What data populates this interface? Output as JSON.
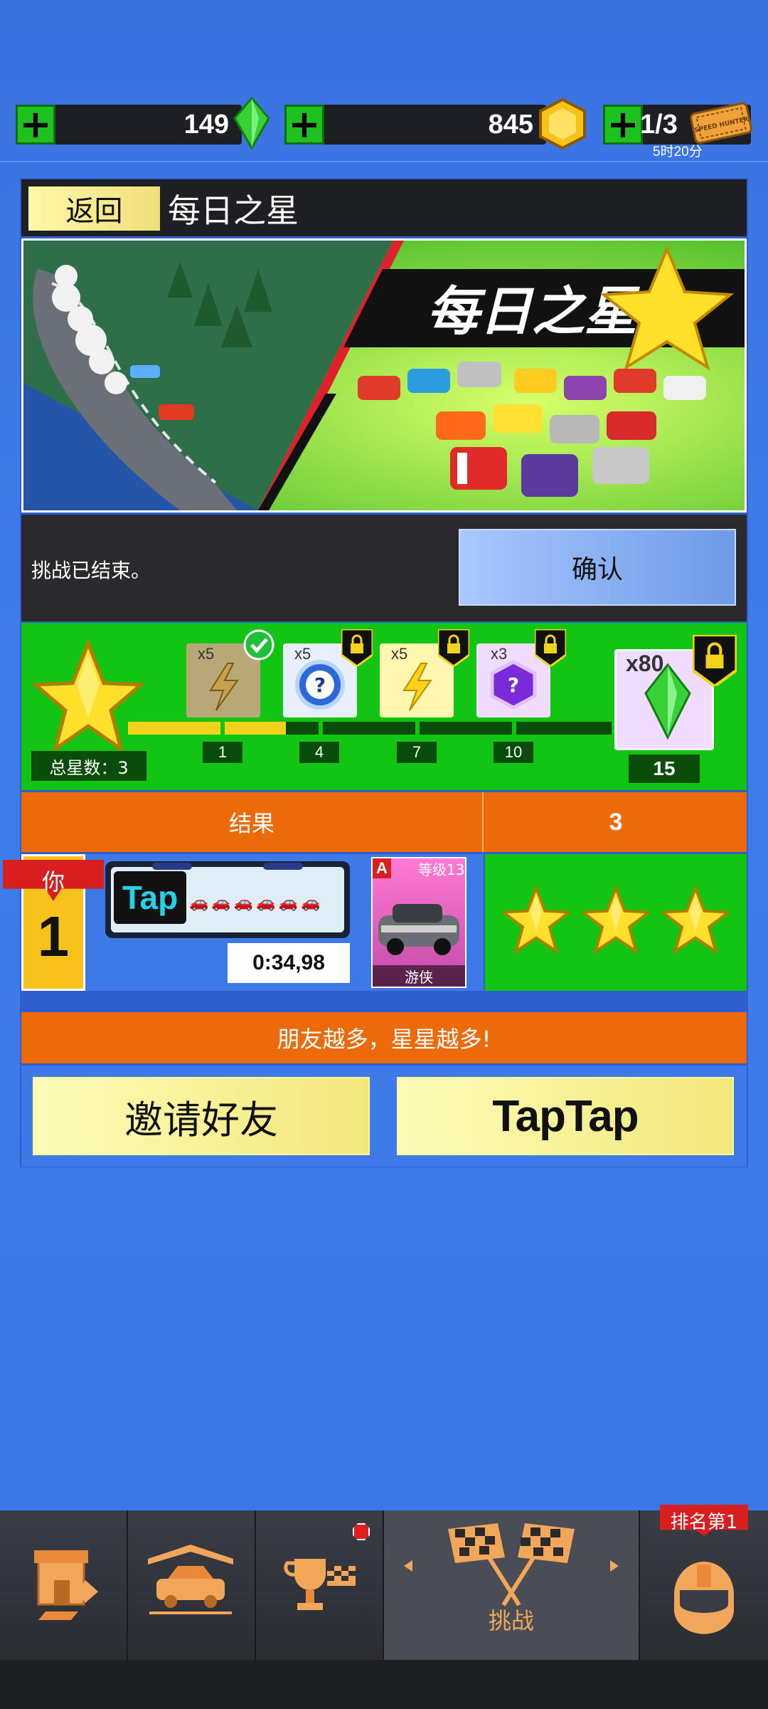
{
  "currencies": {
    "gems": {
      "value": "149",
      "icon": "green-gem-icon"
    },
    "coins": {
      "value": "845",
      "icon": "gold-coin-icon"
    },
    "tickets": {
      "value": "1/3",
      "timer": "5时20分",
      "icon": "speed-hunter-ticket-icon",
      "ticket_text": "SPEED HUNTER"
    }
  },
  "header": {
    "back_label": "返回",
    "title": "每日之星"
  },
  "banner": {
    "title": "每日之星"
  },
  "status": {
    "message": "挑战已结束。",
    "confirm_label": "确认"
  },
  "rewards": {
    "total_stars_label": "总星数：3",
    "tiers": [
      {
        "multiplier": "x5",
        "item": "lightning-bolt-icon",
        "stars": "1",
        "claimed": true,
        "locked": false
      },
      {
        "multiplier": "x5",
        "item": "mystery-blue-icon",
        "stars": "4",
        "claimed": false,
        "locked": true
      },
      {
        "multiplier": "x5",
        "item": "lightning-bolt-icon",
        "stars": "7",
        "claimed": false,
        "locked": true
      },
      {
        "multiplier": "x3",
        "item": "mystery-purple-icon",
        "stars": "10",
        "claimed": false,
        "locked": true
      },
      {
        "multiplier": "x80",
        "item": "green-gem-icon",
        "stars": "15",
        "claimed": false,
        "locked": true
      }
    ],
    "progress_segments_filled": 1.5,
    "progress_segments_total": 5
  },
  "results": {
    "label": "结果",
    "value": "3"
  },
  "player": {
    "you_label": "你",
    "rank": "1",
    "plate_text": "Tap",
    "time": "0:34,98",
    "car_grade": "A",
    "car_level": "等级13",
    "car_name": "游侠",
    "stars_earned": 3
  },
  "friends": {
    "banner": "朋友越多，星星越多!",
    "invite_label": "邀请好友",
    "taptap_label": "TapTap"
  },
  "nav": {
    "items": [
      {
        "name": "shop",
        "icon": "shop-icon"
      },
      {
        "name": "garage",
        "icon": "car-garage-icon"
      },
      {
        "name": "events",
        "icon": "trophy-flag-icon",
        "has_dot": true
      },
      {
        "name": "challenge",
        "icon": "checkered-flags-icon",
        "label": "挑战",
        "active": true
      },
      {
        "name": "profile",
        "icon": "helmet-icon",
        "badge": "排名第1"
      }
    ]
  },
  "colors": {
    "accent_green": "#12c512",
    "accent_orange": "#ec6a0a",
    "bg_blue": "#3d7ae8",
    "button_yellow": "#f2e77a"
  }
}
